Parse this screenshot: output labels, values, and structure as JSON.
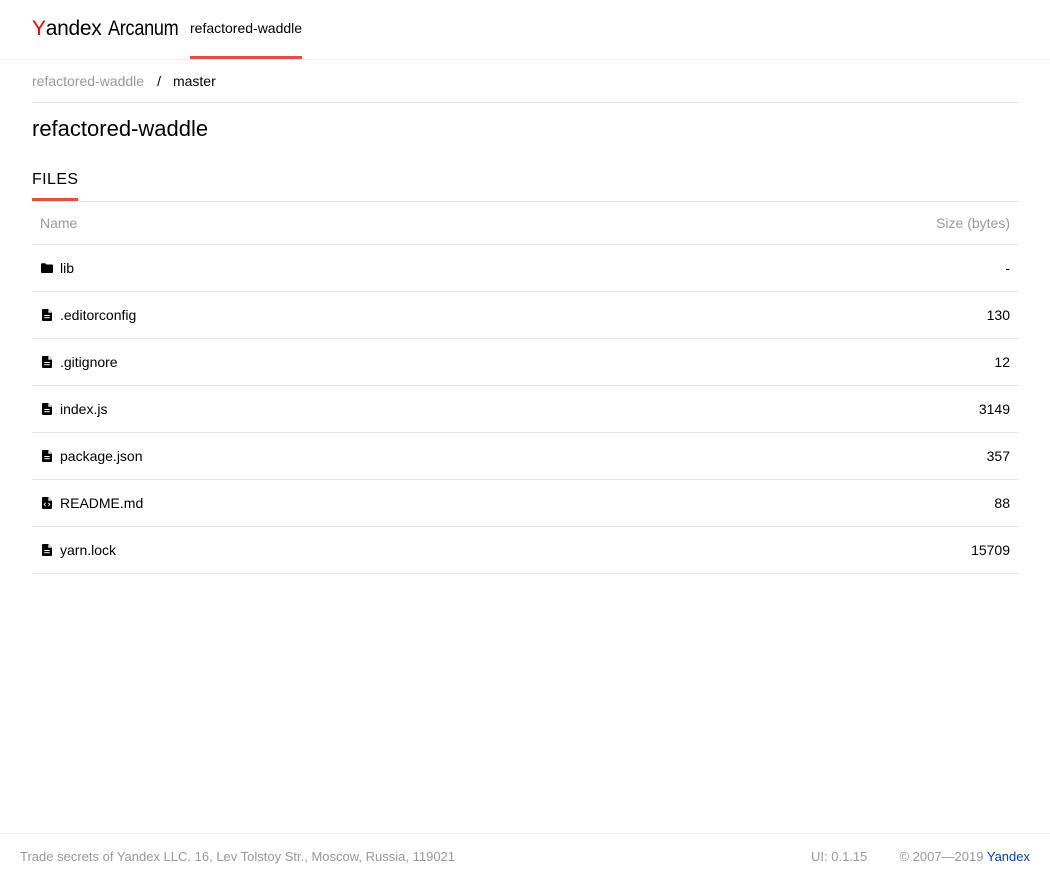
{
  "header": {
    "logo": {
      "first_letter": "Y",
      "brand_rest": "andex",
      "product": "Arcanum"
    },
    "active_tab": "refactored-waddle"
  },
  "breadcrumb": {
    "repo": "refactored-waddle",
    "separator": "/",
    "branch": "master"
  },
  "page_title": "refactored-waddle",
  "tabs": {
    "files": "FILES"
  },
  "table": {
    "headers": {
      "name": "Name",
      "size": "Size (bytes)"
    },
    "rows": [
      {
        "icon": "folder-icon",
        "name": "lib",
        "size": "-"
      },
      {
        "icon": "file-icon",
        "name": ".editorconfig",
        "size": "130"
      },
      {
        "icon": "file-icon",
        "name": ".gitignore",
        "size": "12"
      },
      {
        "icon": "file-icon",
        "name": "index.js",
        "size": "3149"
      },
      {
        "icon": "file-icon",
        "name": "package.json",
        "size": "357"
      },
      {
        "icon": "code-file-icon",
        "name": "README.md",
        "size": "88"
      },
      {
        "icon": "file-icon",
        "name": "yarn.lock",
        "size": "15709"
      }
    ]
  },
  "footer": {
    "legal": "Trade secrets of Yandex LLC. 16, Lev Tolstoy Str., Moscow, Russia, 119021",
    "version": "UI: 0.1.15",
    "copyright": "© 2007—2019",
    "yandex_link": "Yandex"
  },
  "colors": {
    "accent": "#e84e3c",
    "logo_red": "#ff0000",
    "muted_text": "#999999",
    "link": "#0044bb",
    "divider": "#e6e6e6"
  }
}
